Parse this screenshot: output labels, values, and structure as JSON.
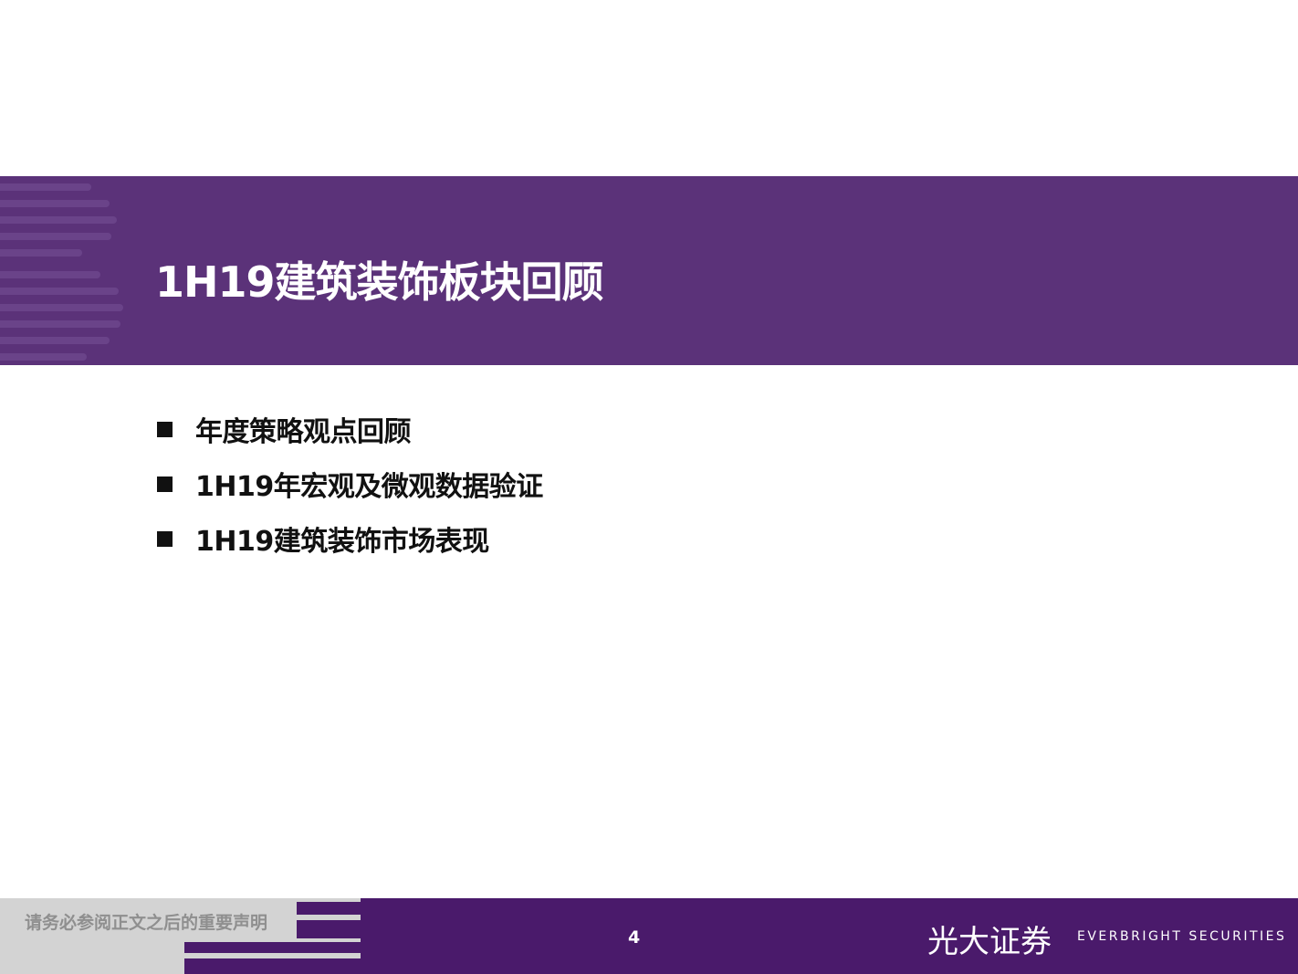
{
  "title": "1H19建筑装饰板块回顾",
  "bullets": [
    "年度策略观点回顾",
    "1H19年宏观及微观数据验证",
    "1H19建筑装饰市场表现"
  ],
  "footer": {
    "disclaimer": "请务必参阅正文之后的重要声明",
    "page_number": "4",
    "logo_cn": "光大证券",
    "logo_en": "EVERBRIGHT SECURITIES"
  },
  "colors": {
    "banner": "#5b3279",
    "footer": "#4a1a6b"
  }
}
